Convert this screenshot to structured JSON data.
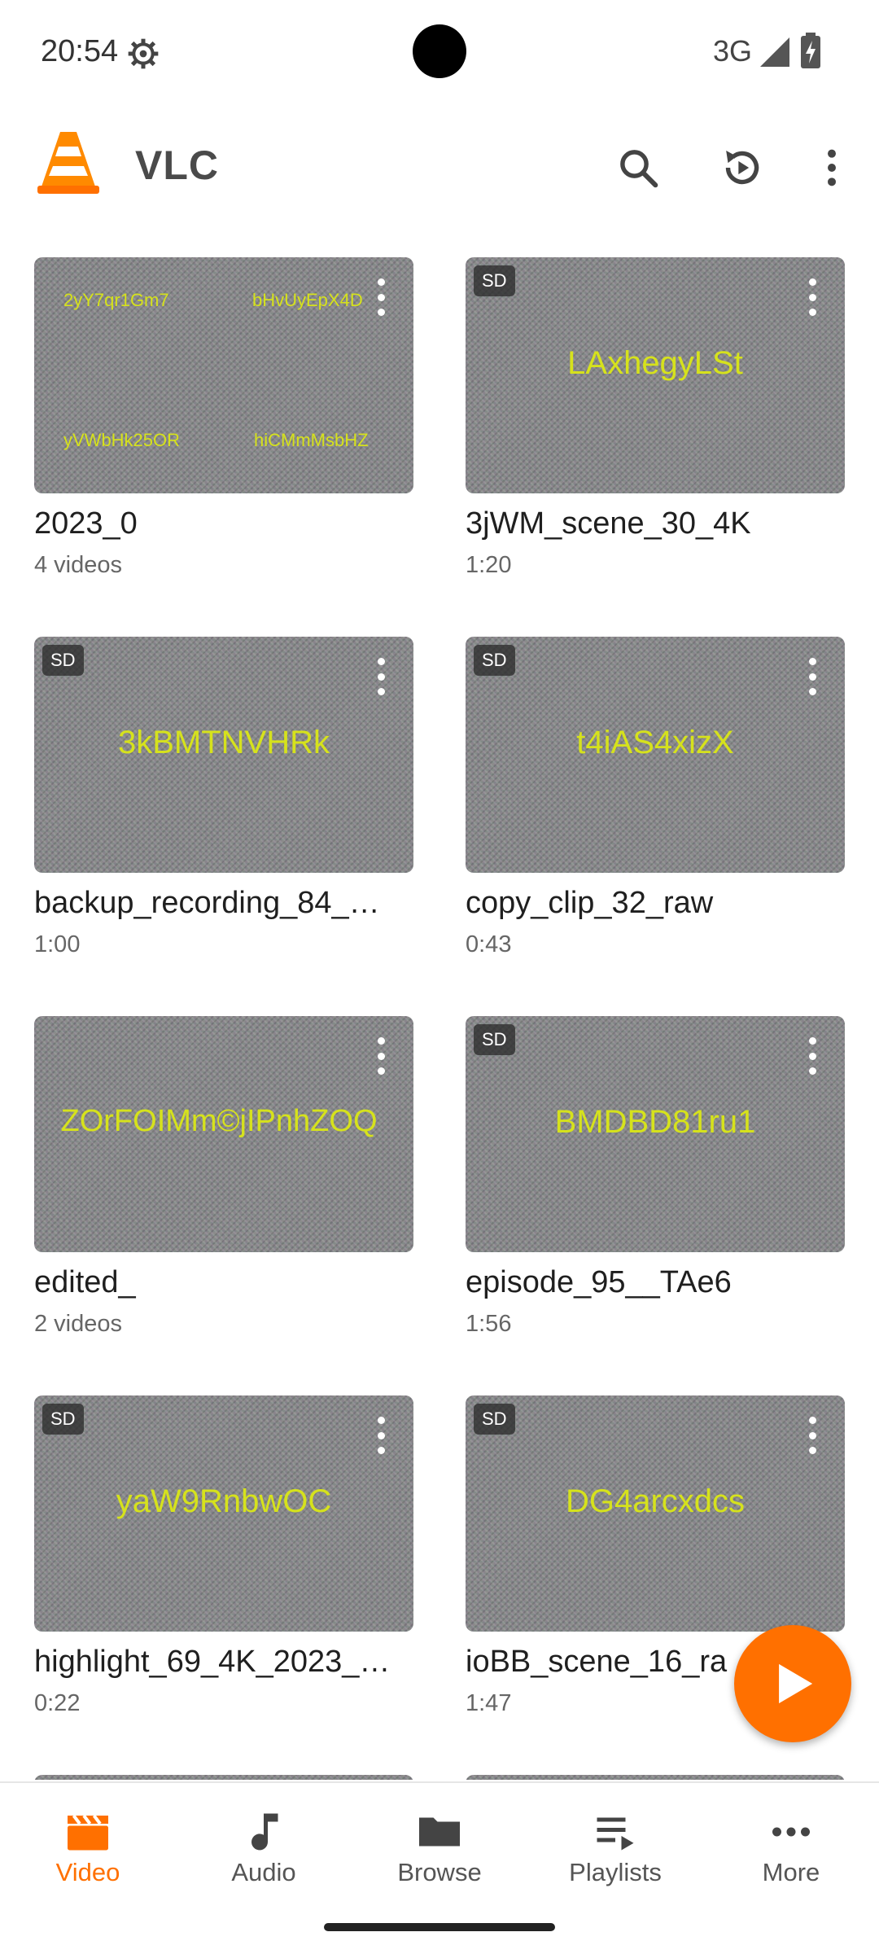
{
  "status_bar": {
    "time": "20:54",
    "network": "3G"
  },
  "app_bar": {
    "title": "VLC"
  },
  "videos": [
    {
      "title": "2023_0",
      "subtitle": "4 videos",
      "sd": false,
      "overlay_small": [
        "2yY7qr1Gm7",
        "bHvUyEpX4D",
        "yVWbHk25OR",
        "hiCMmMsbHZ"
      ]
    },
    {
      "title": "3jWM_scene_30_4K",
      "subtitle": "1:20",
      "sd": true,
      "overlay_text": "LAxhegyLSt"
    },
    {
      "title": "backup_recording_84_…",
      "subtitle": "1:00",
      "sd": true,
      "overlay_text": "3kBMTNVHRk"
    },
    {
      "title": "copy_clip_32_raw",
      "subtitle": "0:43",
      "sd": true,
      "overlay_text": "t4iAS4xizX"
    },
    {
      "title": "edited_",
      "subtitle": "2 videos",
      "sd": false,
      "overlay_text": "ZOrFOIMm©jIPnhZOQ"
    },
    {
      "title": "episode_95__TAe6",
      "subtitle": "1:56",
      "sd": true,
      "overlay_text": "BMDBD81ru1"
    },
    {
      "title": "highlight_69_4K_2023_…",
      "subtitle": "0:22",
      "sd": true,
      "overlay_text": "yaW9RnbwOC"
    },
    {
      "title": "ioBB_scene_16_ra",
      "subtitle": "1:47",
      "sd": true,
      "overlay_text": "DG4arcxdcs"
    }
  ],
  "badge_label": "SD",
  "bottom_nav": {
    "items": [
      {
        "label": "Video",
        "active": true
      },
      {
        "label": "Audio",
        "active": false
      },
      {
        "label": "Browse",
        "active": false
      },
      {
        "label": "Playlists",
        "active": false
      },
      {
        "label": "More",
        "active": false
      }
    ]
  },
  "colors": {
    "accent": "#ff7000",
    "thumb_text": "#d6e21c"
  }
}
